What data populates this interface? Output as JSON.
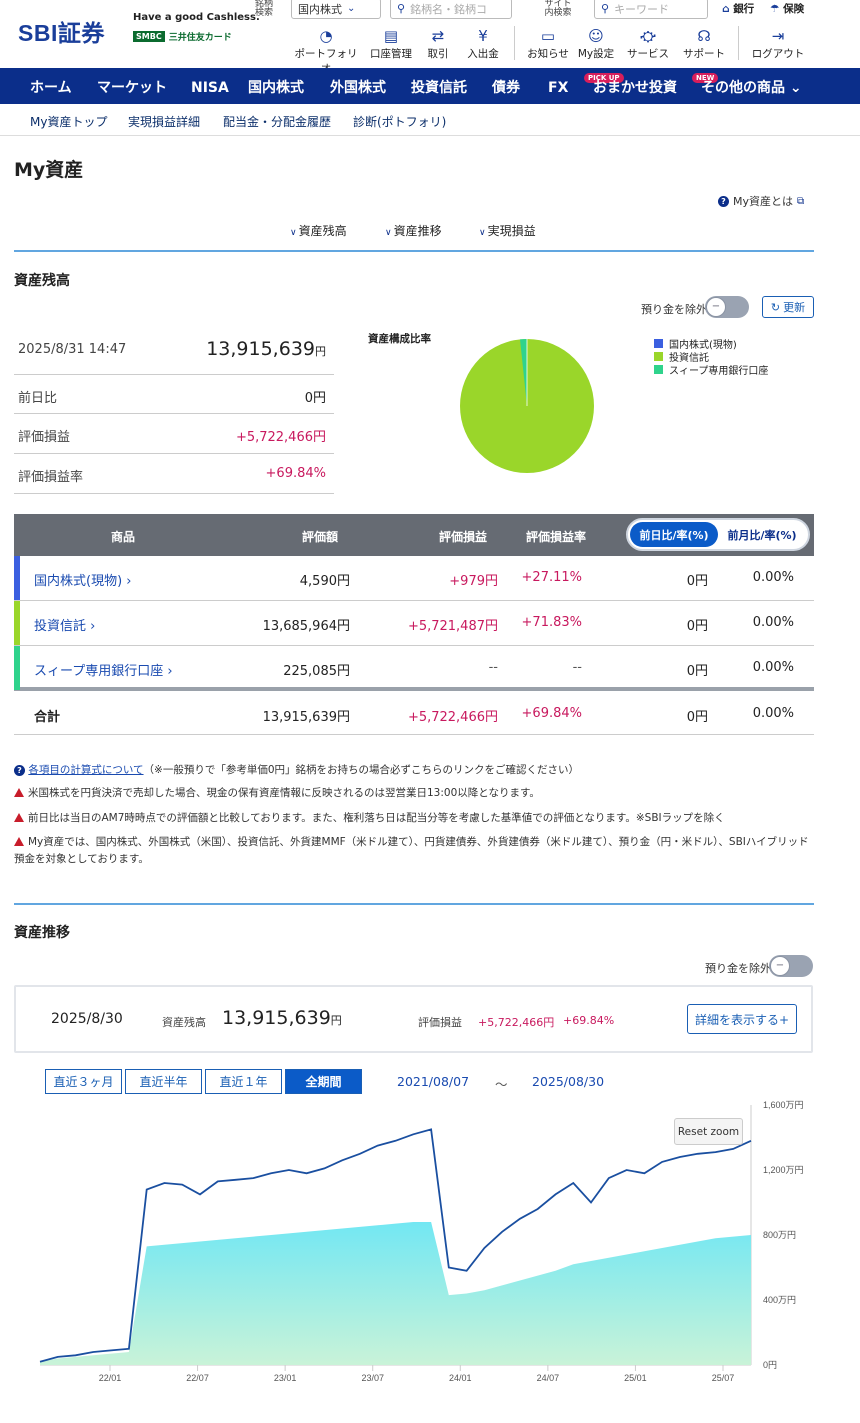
{
  "header": {
    "logo_text": "SBI証券",
    "cashless": "Have a good Cashless.",
    "smbc_badge": "SMBC",
    "smbc_card": "三井住友カード",
    "stock_search_label": "銘柄\n検索",
    "stock_search_label_1": "銘柄",
    "stock_search_label_2": "検索",
    "market_select": "国内株式",
    "stock_placeholder": "銘柄名・銘柄コ",
    "site_search_label_1": "サイト",
    "site_search_label_2": "内検索",
    "site_placeholder": "キーワード",
    "bank": "銀行",
    "insurance": "保険",
    "icons": [
      {
        "label": "ポートフォリオ",
        "icon": "portfolio-icon"
      },
      {
        "label": "口座管理",
        "icon": "account-icon"
      },
      {
        "label": "取引",
        "icon": "trade-icon"
      },
      {
        "label": "入出金",
        "icon": "deposit-icon"
      },
      {
        "label": "お知らせ",
        "icon": "notice-icon"
      },
      {
        "label": "My設定",
        "icon": "settings-icon"
      },
      {
        "label": "サービス",
        "icon": "service-icon"
      },
      {
        "label": "サポート",
        "icon": "support-icon"
      },
      {
        "label": "ログアウト",
        "icon": "logout-icon"
      }
    ]
  },
  "nav": {
    "items": [
      "ホーム",
      "マーケット",
      "NISA",
      "国内株式",
      "外国株式",
      "投資信託",
      "債券",
      "FX",
      "おまかせ投資",
      "その他の商品"
    ],
    "pickup_badge": "PICK UP",
    "new_badge": "NEW"
  },
  "subnav": [
    "My資産トップ",
    "実現損益詳細",
    "配当金・分配金履歴",
    "診断(ポトフォリ)"
  ],
  "page": {
    "title": "My資産",
    "what_is": "My資産とは",
    "anchors": [
      "資産残高",
      "資産推移",
      "実現損益"
    ]
  },
  "balance": {
    "section_title": "資産残高",
    "exclude_deposit": "預り金を除外",
    "refresh": "更新",
    "datetime": "2025/8/31 14:47",
    "total": "13,915,639",
    "yen": "円",
    "rows": [
      {
        "label": "前日比",
        "value": "0円"
      },
      {
        "label": "評価損益",
        "value": "+5,722,466円"
      },
      {
        "label": "評価損益率",
        "value": "+69.84%"
      }
    ],
    "pie_title": "資産構成比率",
    "legend": [
      {
        "name": "国内株式(現物)",
        "color": "#3b5fe0"
      },
      {
        "name": "投資信託",
        "color": "#9ad62a"
      },
      {
        "name": "スィープ専用銀行口座",
        "color": "#2fd38c"
      }
    ]
  },
  "table": {
    "headers": [
      "商品",
      "評価額",
      "評価損益",
      "評価損益率"
    ],
    "seg_day": "前日比/率(%)",
    "seg_month": "前月比/率(%)",
    "rows": [
      {
        "name": "国内株式(現物)",
        "value": "4,590円",
        "pl": "+979円",
        "rate": "+27.11%",
        "diff": "0円",
        "diff_rate": "0.00%",
        "color": "#3b5fe0"
      },
      {
        "name": "投資信託",
        "value": "13,685,964円",
        "pl": "+5,721,487円",
        "rate": "+71.83%",
        "diff": "0円",
        "diff_rate": "0.00%",
        "color": "#9ad62a"
      },
      {
        "name": "スィープ専用銀行口座",
        "value": "225,085円",
        "pl": "--",
        "rate": "--",
        "diff": "0円",
        "diff_rate": "0.00%",
        "color": "#2fd38c"
      }
    ],
    "total": {
      "name": "合計",
      "value": "13,915,639円",
      "pl": "+5,722,466円",
      "rate": "+69.84%",
      "diff": "0円",
      "diff_rate": "0.00%"
    }
  },
  "notes": {
    "calc_link": "各項目の計算式について",
    "calc_rest": "（※一般預りで「参考単価0円」銘柄をお持ちの場合必ずこちらのリンクをご確認ください）",
    "n1": "米国株式を円貨決済で売却した場合、現金の保有資産情報に反映されるのは翌営業日13:00以降となります。",
    "n2": "前日比は当日のAM7時時点での評価額と比較しております。また、権利落ち日は配当分等を考慮した基準値での評価となります。※SBIラップを除く",
    "n3": "My資産では、国内株式、外国株式（米国）、投資信託、外貨建MMF（米ドル建て）、円貨建債券、外貨建債券（米ドル建て）、預り金（円・米ドル）、SBIハイブリッド預金を対象としております。"
  },
  "history": {
    "section_title": "資産推移",
    "exclude_deposit": "預り金を除外",
    "date": "2025/8/30",
    "balance_label": "資産残高",
    "balance": "13,915,639",
    "yen": "円",
    "pl_label": "評価損益",
    "pl": "+5,722,466円",
    "pl_rate": "+69.84%",
    "detail_btn": "詳細を表示する+",
    "ranges": [
      "直近３ヶ月",
      "直近半年",
      "直近１年",
      "全期間"
    ],
    "from": "2021/08/07",
    "tilde": "〜",
    "to": "2025/08/30",
    "reset_zoom": "Reset zoom"
  },
  "chart_data": {
    "type": "area",
    "x_ticks": [
      "22/01",
      "22/07",
      "23/01",
      "23/07",
      "24/01",
      "24/07",
      "25/01",
      "25/07"
    ],
    "y_ticks": [
      "0円",
      "400万円",
      "800万円",
      "1,200万円",
      "1,600万円"
    ],
    "ylim": [
      0,
      1600
    ],
    "series": [
      {
        "values": [
          20,
          50,
          60,
          80,
          90,
          100,
          1080,
          1120,
          1110,
          1050,
          1130,
          1140,
          1150,
          1180,
          1200,
          1180,
          1210,
          1260,
          1300,
          1350,
          1380,
          1420,
          1450,
          600,
          580,
          720,
          820,
          900,
          960,
          1050,
          1120,
          1000,
          1150,
          1200,
          1180,
          1250,
          1280,
          1300,
          1310,
          1330,
          1380
        ]
      },
      {
        "values": [
          20,
          40,
          50,
          60,
          70,
          80,
          730,
          740,
          750,
          760,
          770,
          780,
          790,
          800,
          810,
          820,
          830,
          840,
          850,
          860,
          870,
          880,
          880,
          430,
          440,
          460,
          490,
          520,
          550,
          580,
          620,
          640,
          660,
          680,
          700,
          720,
          740,
          760,
          780,
          790,
          800
        ]
      }
    ]
  },
  "colors": {
    "brand": "#1a3e9a",
    "nav": "#0b2e8a",
    "positive": "#c8195e",
    "accent": "#0b5bc8"
  }
}
